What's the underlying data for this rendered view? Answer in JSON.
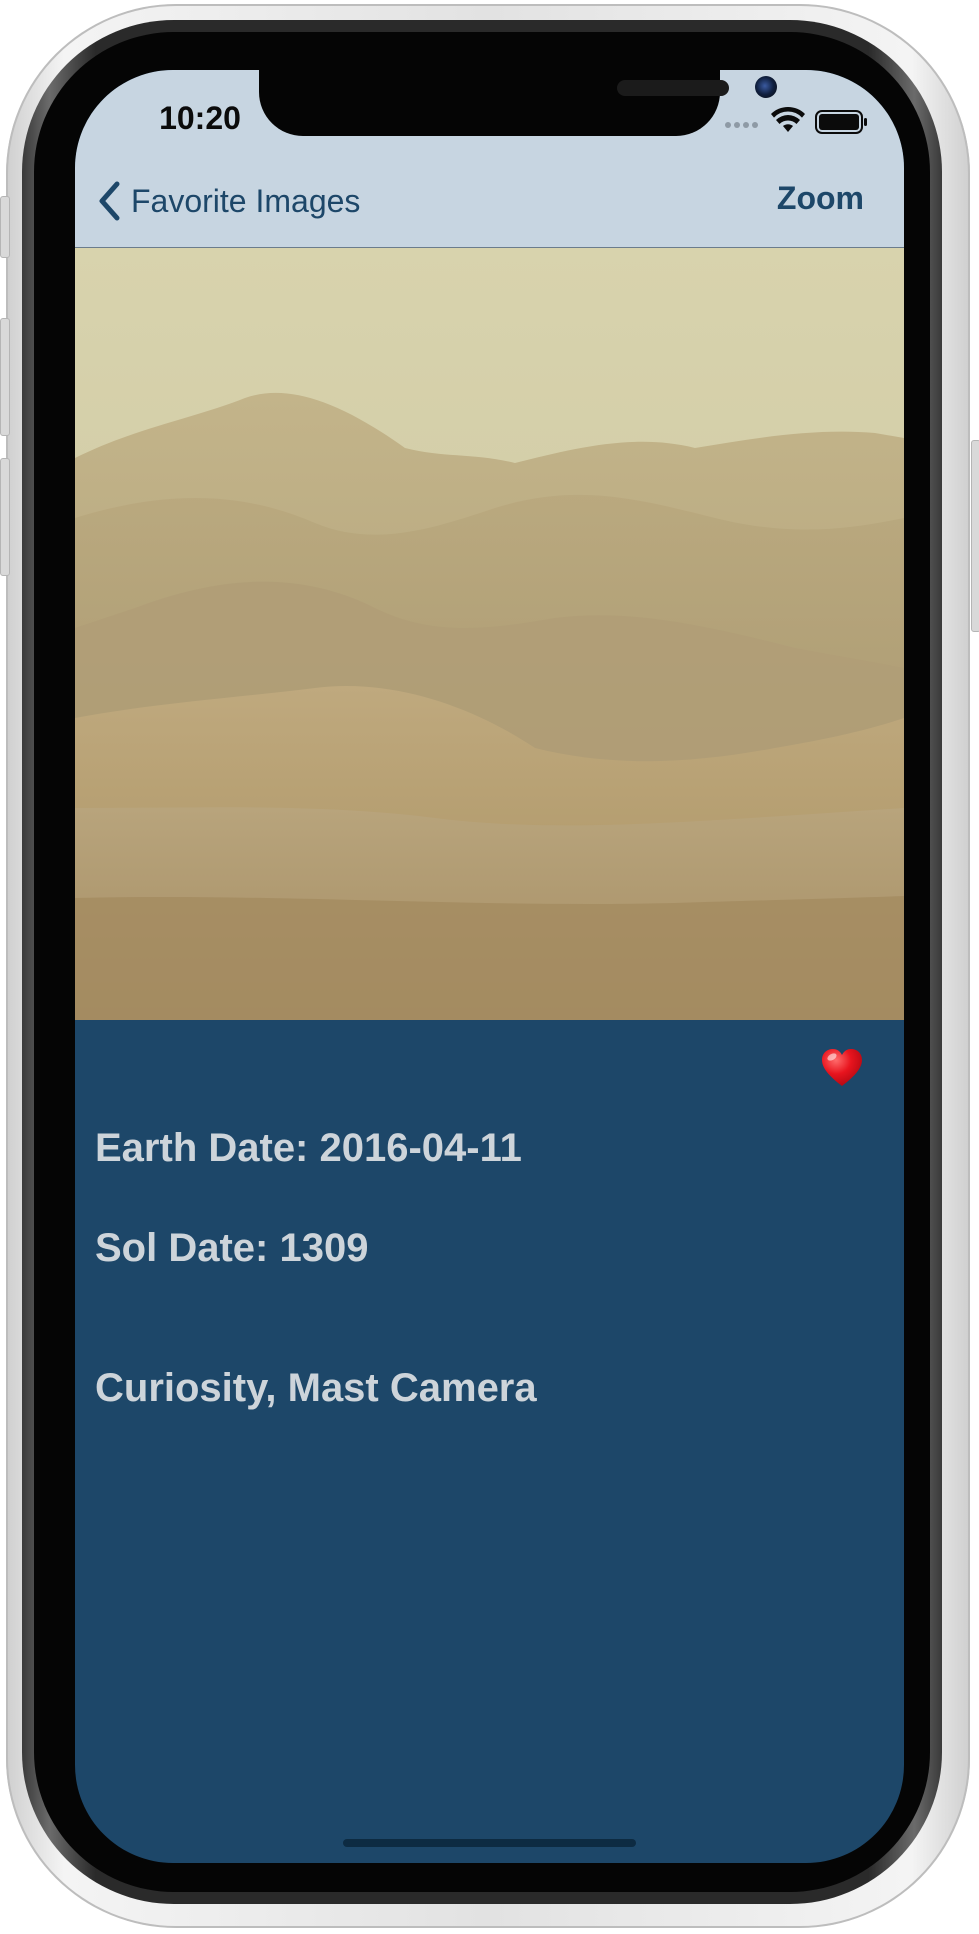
{
  "status_bar": {
    "time": "10:20"
  },
  "nav": {
    "back_label": "Favorite Images",
    "zoom_label": "Zoom"
  },
  "photo": {
    "subject": "Martian dunes photo"
  },
  "details": {
    "earth_date": "Earth Date: 2016-04-11",
    "sol_date": "Sol Date: 1309",
    "rover_camera": "Curiosity, Mast Camera",
    "favorite_icon": "heart-icon"
  },
  "colors": {
    "nav_background": "#c7d5e1",
    "accent": "#1d4769",
    "detail_background": "#1d4769",
    "detail_text": "#cdd4da",
    "heart": "#e8141e"
  }
}
